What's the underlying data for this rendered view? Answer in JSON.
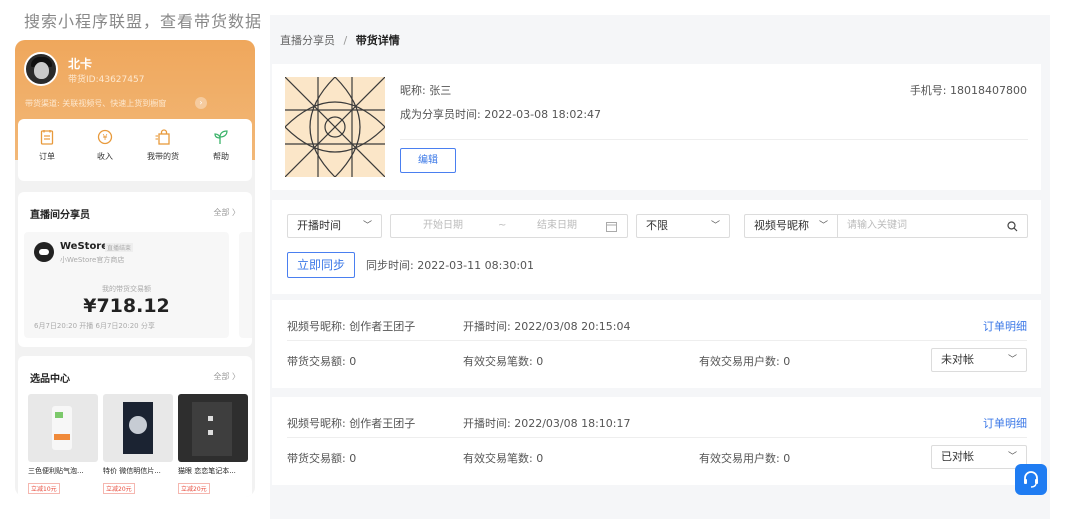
{
  "left_panel": {
    "title": "搜索小程序联盟，查看带货数据",
    "user": {
      "name": "北卡",
      "id_text": "带货ID:43627457",
      "channel_text": "带货渠道: 关联视频号、快速上货到橱窗",
      "channel_arrow": "›"
    },
    "menu": [
      {
        "label": "订单",
        "icon": "order-icon"
      },
      {
        "label": "收入",
        "icon": "income-icon"
      },
      {
        "label": "我带的货",
        "icon": "bag-icon"
      },
      {
        "label": "帮助",
        "icon": "sprout-icon"
      }
    ],
    "live_section": {
      "title": "直播间分享员",
      "all": "全部 〉",
      "store": {
        "name": "WeStore",
        "badge": "直播结束",
        "sub": "小WeStore官方商店",
        "amount_label": "我的带货交易额",
        "amount": "¥718.12",
        "time": "6月7日20:20 开播   6月7日20:20 分享"
      }
    },
    "select_section": {
      "title": "选品中心",
      "all": "全部 〉",
      "products": [
        {
          "name": "三色便利贴气泡...",
          "tag": "立减10元"
        },
        {
          "name": "特价 微信明信片...",
          "tag": "立减20元"
        },
        {
          "name": "猫眼 恋恋笔记本...",
          "tag": "立减20元"
        }
      ]
    }
  },
  "breadcrumb": {
    "parent": "直播分享员",
    "sep": "/",
    "current": "带货详情"
  },
  "profile": {
    "nickname": "昵称: 张三",
    "since": "成为分享员时间: 2022-03-08 18:02:47",
    "phone": "手机号: 18018407800",
    "edit_label": "编辑"
  },
  "filter": {
    "time_type": "开播时间",
    "start_placeholder": "开始日期",
    "range_sep": "~",
    "end_placeholder": "结束日期",
    "status": "不限",
    "keyword_type": "视频号昵称",
    "keyword_placeholder": "请输入关键词",
    "sync_label": "立即同步",
    "sync_time": "同步时间: 2022-03-11 08:30:01"
  },
  "records": [
    {
      "nickname": "视频号昵称: 创作者王团子",
      "start": "开播时间: 2022/03/08 20:15:04",
      "detail": "订单明细",
      "gmv": "带货交易额: 0",
      "orders": "有效交易笔数: 0",
      "users": "有效交易用户数: 0",
      "status": "未对帐"
    },
    {
      "nickname": "视频号昵称: 创作者王团子",
      "start": "开播时间: 2022/03/08 18:10:17",
      "detail": "订单明细",
      "gmv": "带货交易额: 0",
      "orders": "有效交易笔数: 0",
      "users": "有效交易用户数: 0",
      "status": "已对帐"
    }
  ],
  "colors": {
    "brand_blue": "#3b78e7",
    "orange": "#efa75c",
    "bg": "#f5f6f8"
  }
}
